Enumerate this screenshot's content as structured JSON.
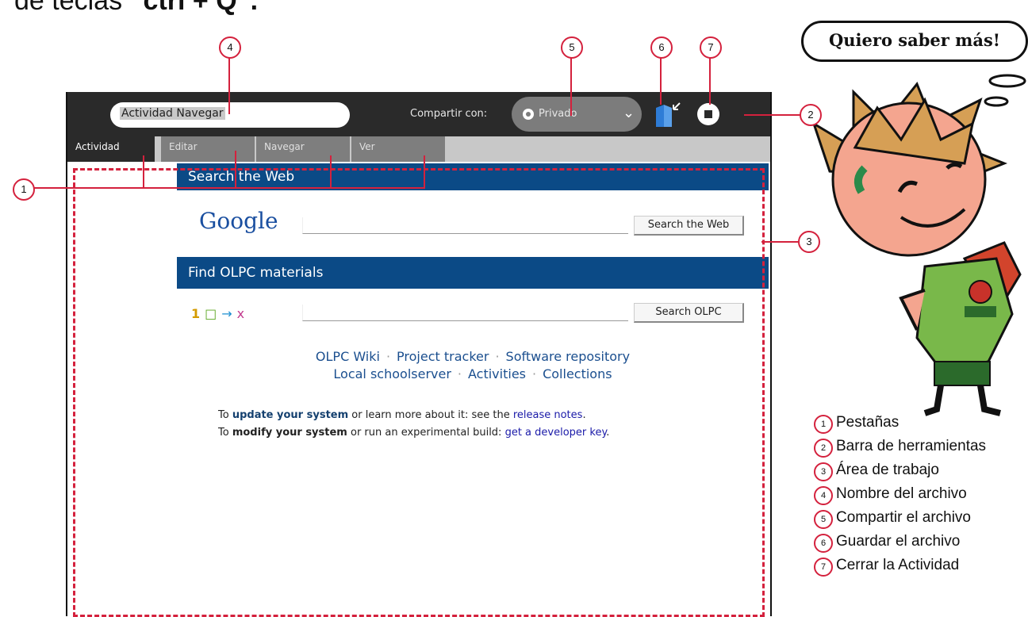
{
  "header_text": {
    "prefix": "de teclas",
    "shortcut": "“ctrl + Q”."
  },
  "bubble_text": "Quiero saber más!",
  "toolbar": {
    "title_value": "Actividad Navegar",
    "share_label": "Compartir con:",
    "share_value": "Privado",
    "share_icon": "radio-dot-icon",
    "chevron_icon": "chevron-down-icon",
    "save_icon": "journal-save-icon",
    "stop_icon": "stop-icon"
  },
  "tabs": [
    {
      "label": "Actividad"
    },
    {
      "label": "Editar"
    },
    {
      "label": "Navegar"
    },
    {
      "label": "Ver"
    }
  ],
  "content": {
    "search_web_bar": "Search the Web",
    "google_logo": "Google",
    "search_web_button": "Search the Web",
    "olpc_bar": "Find OLPC materials",
    "olpc_icons": [
      "1",
      "□",
      "→",
      "x"
    ],
    "search_olpc_button": "Search  OLPC",
    "links_row1": [
      "OLPC Wiki",
      "Project tracker",
      "Software repository"
    ],
    "links_row2": [
      "Local schoolserver",
      "Activities",
      "Collections"
    ],
    "note1": {
      "p1": "To ",
      "kw": "update your system",
      "p2": " or learn more about it: see the ",
      "link": "release notes",
      "p3": "."
    },
    "note2": {
      "p1": "To ",
      "kw": "modify your system",
      "p2": " or run an experimental build: ",
      "link": "get a developer key",
      "p3": "."
    }
  },
  "callouts": [
    "1",
    "2",
    "3",
    "4",
    "5",
    "6",
    "7"
  ],
  "legend": [
    {
      "num": "1",
      "label": "Pestañas"
    },
    {
      "num": "2",
      "label": "Barra de herramientas"
    },
    {
      "num": "3",
      "label": "Área de trabajo"
    },
    {
      "num": "4",
      "label": "Nombre del archivo"
    },
    {
      "num": "5",
      "label": "Compartir el archivo"
    },
    {
      "num": "6",
      "label": "Guardar el archivo"
    },
    {
      "num": "7",
      "label": "Cerrar la Actividad"
    }
  ],
  "colors": {
    "accent": "#d4213d",
    "toolbar": "#2a2a2a",
    "blue_bar": "#0b4a86"
  }
}
